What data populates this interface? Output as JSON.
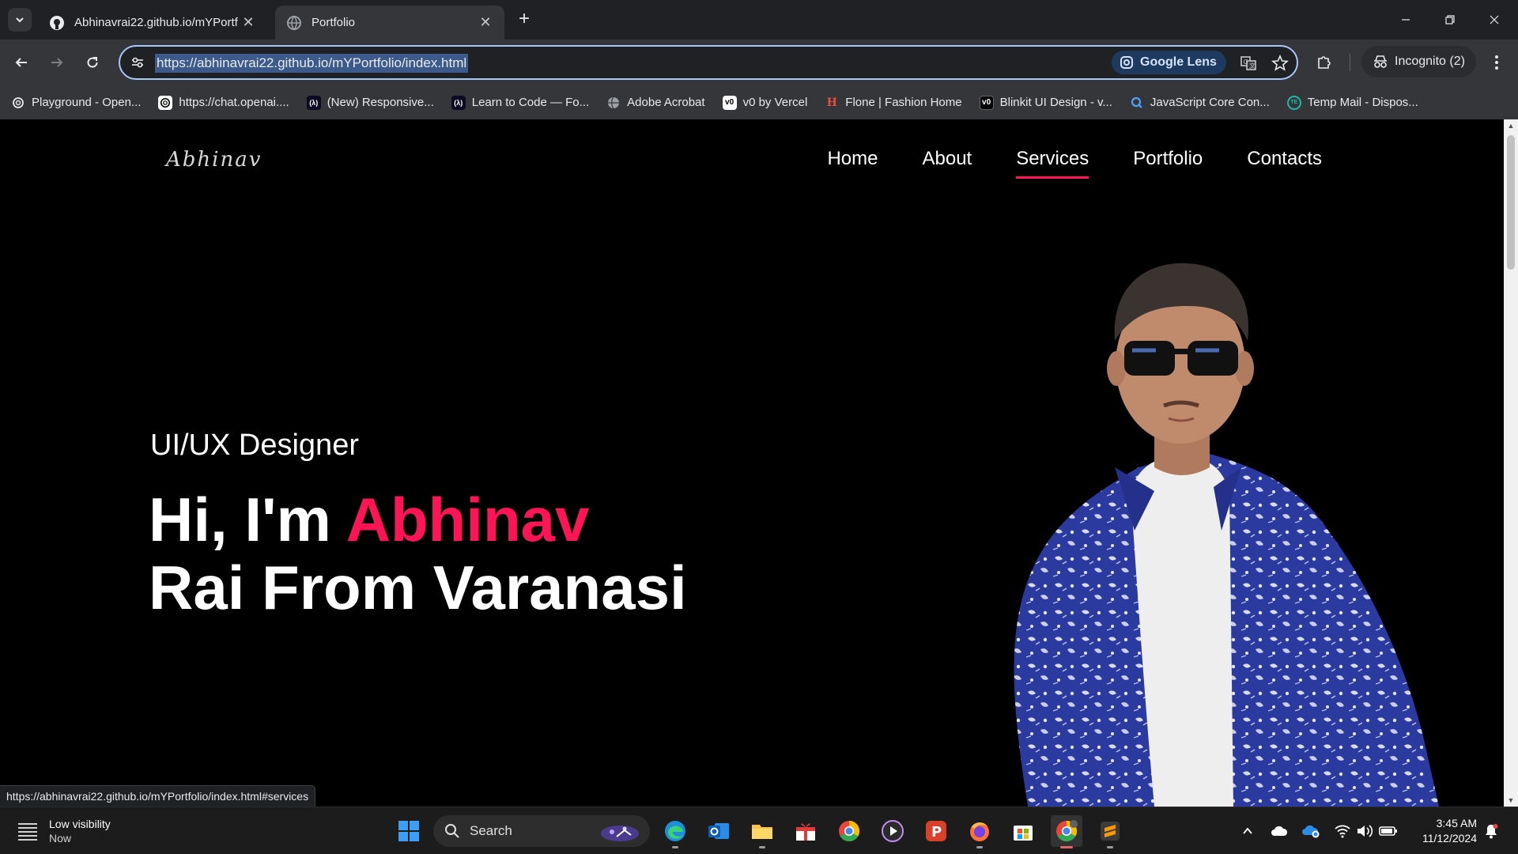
{
  "browser": {
    "tabs": [
      {
        "title": "Abhinavrai22.github.io/mYPortf",
        "active": false
      },
      {
        "title": "Portfolio",
        "active": true
      }
    ],
    "url": "https://abhinavrai22.github.io/mYPortfolio/index.html",
    "lens_label": "Google Lens",
    "incognito_label": "Incognito (2)",
    "bookmarks": [
      {
        "label": "Playground - Open...",
        "icon": "openai-icon"
      },
      {
        "label": "https://chat.openai....",
        "icon": "openai-icon"
      },
      {
        "label": "(New) Responsive...",
        "icon": "freecodecamp-icon"
      },
      {
        "label": "Learn to Code — Fo...",
        "icon": "freecodecamp-icon"
      },
      {
        "label": "Adobe Acrobat",
        "icon": "globe-icon"
      },
      {
        "label": "v0 by Vercel",
        "icon": "v0-icon"
      },
      {
        "label": "Flone | Fashion Home",
        "icon": "flone-icon"
      },
      {
        "label": "Blinkit UI Design - v...",
        "icon": "v0-icon"
      },
      {
        "label": "JavaScript Core Con...",
        "icon": "search-q-icon"
      },
      {
        "label": "Temp Mail - Dispos...",
        "icon": "tempmail-icon"
      }
    ],
    "status_url": "https://abhinavrai22.github.io/mYPortfolio/index.html#services"
  },
  "page": {
    "logo": "Abhinav",
    "nav": [
      {
        "label": "Home",
        "active": false
      },
      {
        "label": "About",
        "active": false
      },
      {
        "label": "Services",
        "active": true
      },
      {
        "label": "Portfolio",
        "active": false
      },
      {
        "label": "Contacts",
        "active": false
      }
    ],
    "hero": {
      "subtitle": "UI/UX Designer",
      "title_prefix": "Hi, I'm ",
      "title_accent": "Abhinav",
      "title_line2": "Rai From Varanasi"
    },
    "accent_color": "#ff1456"
  },
  "taskbar": {
    "weather_title": "Low visibility",
    "weather_sub": "Now",
    "search_label": "Search",
    "time": "3:45 AM",
    "date": "11/12/2024"
  }
}
